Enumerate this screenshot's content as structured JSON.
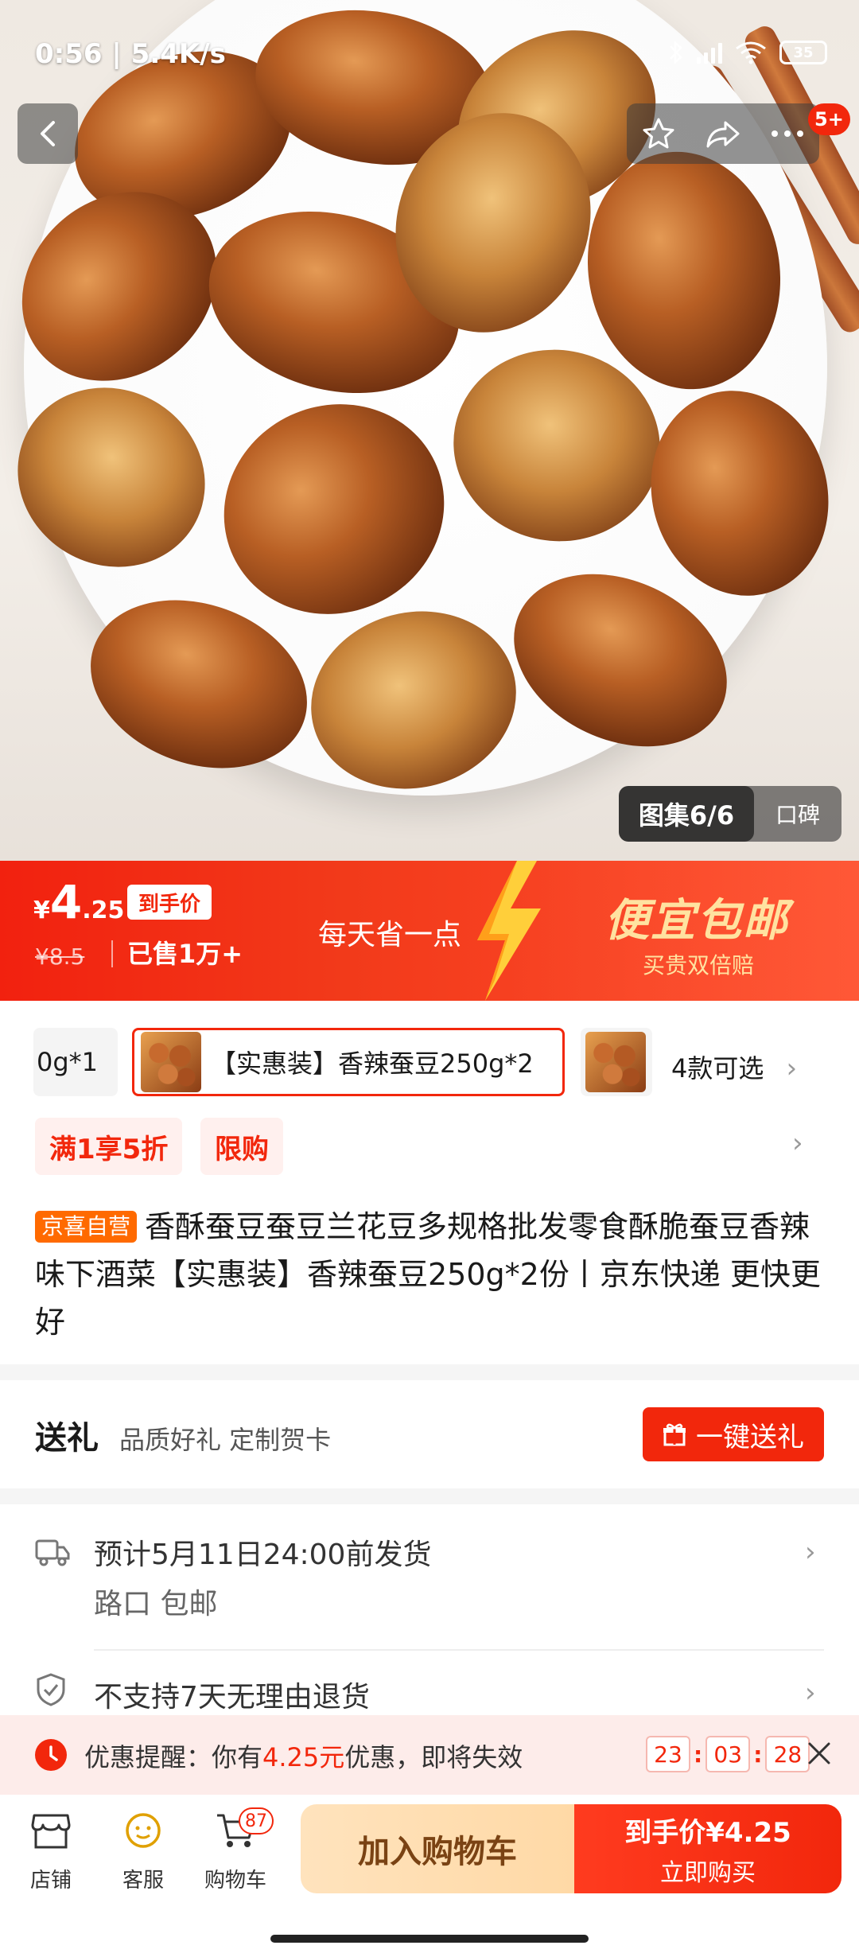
{
  "status": {
    "time": "0:56",
    "speed": "5.4K/s",
    "battery": "35"
  },
  "nav": {
    "more_badge": "5+"
  },
  "gallery": {
    "label": "图集6/6",
    "koubei": "口碑"
  },
  "price": {
    "currency": "¥",
    "integer": "4",
    "decimal": ".25",
    "tag": "到手价",
    "original": "¥8.5",
    "sold": "已售1万+",
    "slogan_left": "每天省一点",
    "slogan_big": "便宜包邮",
    "slogan_small": "买贵双倍赔"
  },
  "variants": {
    "prev_label": "0g*1",
    "active_label": "【实惠装】香辣蚕豆250g*2",
    "count_label": "4款可选"
  },
  "promo": {
    "tag1": "满1享5折",
    "tag2": "限购"
  },
  "title": {
    "badge": "京喜自营",
    "text": "香酥蚕豆蚕豆兰花豆多规格批发零食酥脆蚕豆香辣味下酒菜【实惠装】香辣蚕豆250g*2份丨京东快递 更快更好"
  },
  "gift": {
    "title": "送礼",
    "subtitle": "品质好礼 定制贺卡",
    "button": "一键送礼"
  },
  "shipping": {
    "line1": "预计5月11日24:00前发货",
    "line2": "路口 包邮"
  },
  "returns": {
    "text": "不支持7天无理由退货"
  },
  "reminder": {
    "prefix": "优惠提醒：你有",
    "amount": "4.25元",
    "suffix": "优惠，即将失效",
    "hours": "23",
    "minutes": "03",
    "seconds": "28"
  },
  "bottom": {
    "store": "店铺",
    "service": "客服",
    "cart": "购物车",
    "cart_count": "87",
    "add_cart": "加入购物车",
    "buy_line1": "到手价¥4.25",
    "buy_line2": "立即购买"
  }
}
